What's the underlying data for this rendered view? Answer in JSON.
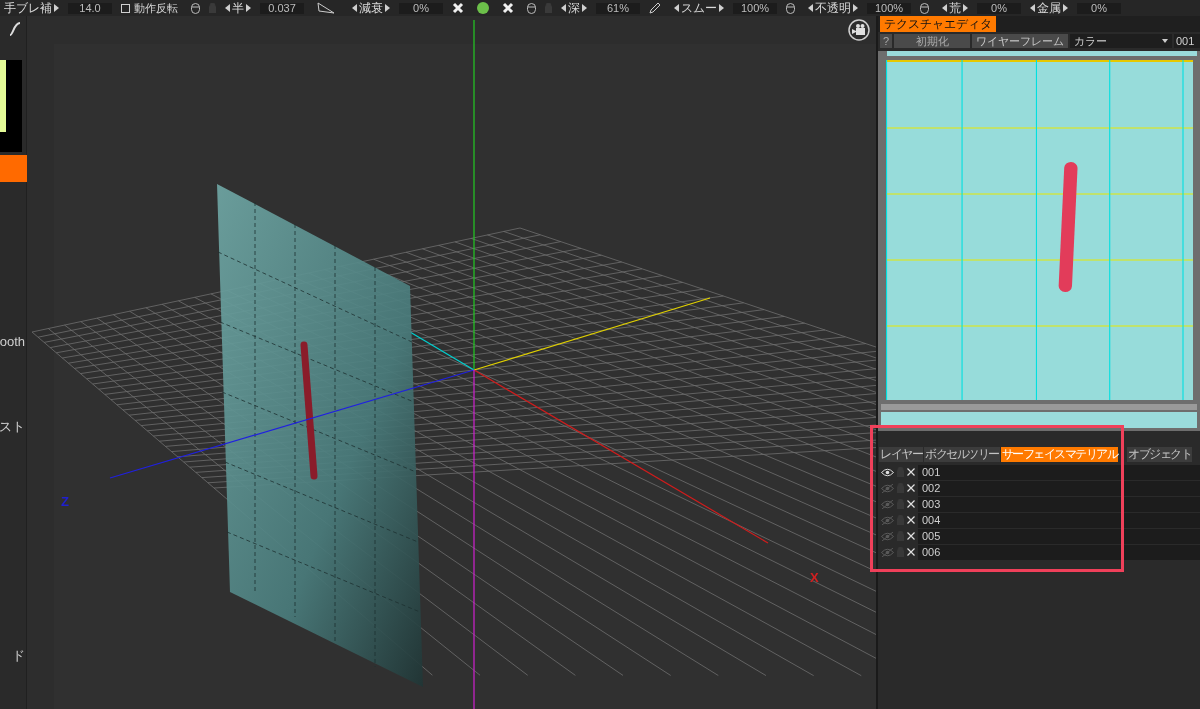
{
  "toolbar": [
    {
      "kind": "label_cut",
      "text": "手ブレ補"
    },
    {
      "kind": "value",
      "text": "14.0"
    },
    {
      "kind": "check",
      "text": "動作反転",
      "checked": false
    },
    {
      "kind": "mouse"
    },
    {
      "kind": "lock"
    },
    {
      "kind": "label",
      "text": "半"
    },
    {
      "kind": "value",
      "text": "0.037"
    },
    {
      "kind": "brush"
    },
    {
      "kind": "label",
      "text": "減衰"
    },
    {
      "kind": "value",
      "text": "0%"
    },
    {
      "kind": "cross"
    },
    {
      "kind": "dot"
    },
    {
      "kind": "cross"
    },
    {
      "kind": "mouse"
    },
    {
      "kind": "lock"
    },
    {
      "kind": "label",
      "text": "深"
    },
    {
      "kind": "value",
      "text": "61%"
    },
    {
      "kind": "pencil"
    },
    {
      "kind": "label",
      "text": "スムー"
    },
    {
      "kind": "value",
      "text": "100%"
    },
    {
      "kind": "mouse"
    },
    {
      "kind": "label",
      "text": "不透明"
    },
    {
      "kind": "value",
      "text": "100%"
    },
    {
      "kind": "mouse"
    },
    {
      "kind": "label",
      "text": "荒"
    },
    {
      "kind": "value",
      "text": "0%"
    },
    {
      "kind": "label",
      "text": "金属"
    },
    {
      "kind": "value",
      "text": "0%"
    }
  ],
  "side_strip": {
    "labels": [
      "ooth",
      "スト",
      "ド"
    ]
  },
  "viewport": {
    "axis_labels": [
      {
        "text": "Z",
        "color": "#2020d0"
      },
      {
        "text": "X",
        "color": "#d02020"
      }
    ]
  },
  "texture_editor": {
    "tab": "テクスチャエディタ",
    "help": "?",
    "reset": "初期化",
    "wireframe": "ワイヤーフレーム",
    "channel": "カラー",
    "number": "001"
  },
  "bottom_panel": {
    "tabs": [
      {
        "label": "レイヤー",
        "selected": false
      },
      {
        "label": "ボクセルツリー",
        "selected": false
      },
      {
        "label": "サーフェイスマテリアル",
        "selected": true
      },
      {
        "label": "オブジェクト",
        "selected": false
      }
    ],
    "rows": [
      {
        "name": "001",
        "visible": true
      },
      {
        "name": "002",
        "visible": false
      },
      {
        "name": "003",
        "visible": false
      },
      {
        "name": "004",
        "visible": false
      },
      {
        "name": "005",
        "visible": false
      },
      {
        "name": "006",
        "visible": false
      }
    ]
  }
}
